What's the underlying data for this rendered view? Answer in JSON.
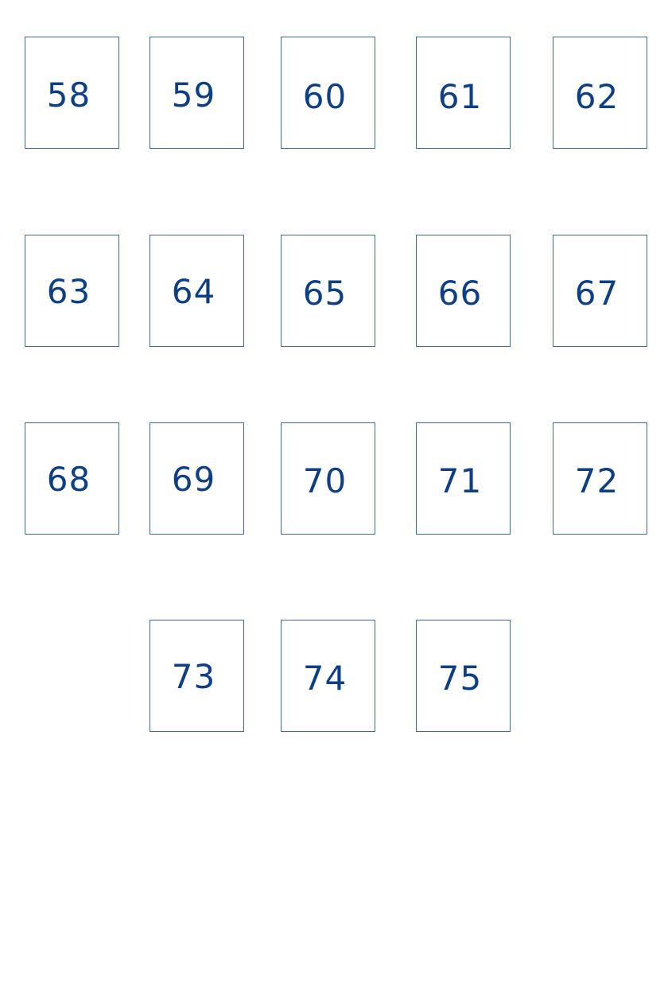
{
  "colors": {
    "tile_border": "#3a68a8",
    "tile_text": "#0d3f86",
    "background": "#ffffff"
  },
  "tiles": [
    {
      "label": "58"
    },
    {
      "label": "59"
    },
    {
      "label": "60"
    },
    {
      "label": "61"
    },
    {
      "label": "62"
    },
    {
      "label": "63"
    },
    {
      "label": "64"
    },
    {
      "label": "65"
    },
    {
      "label": "66"
    },
    {
      "label": "67"
    },
    {
      "label": "68"
    },
    {
      "label": "69"
    },
    {
      "label": "70"
    },
    {
      "label": "71"
    },
    {
      "label": "72"
    },
    {
      "label": "73"
    },
    {
      "label": "74"
    },
    {
      "label": "75"
    }
  ]
}
